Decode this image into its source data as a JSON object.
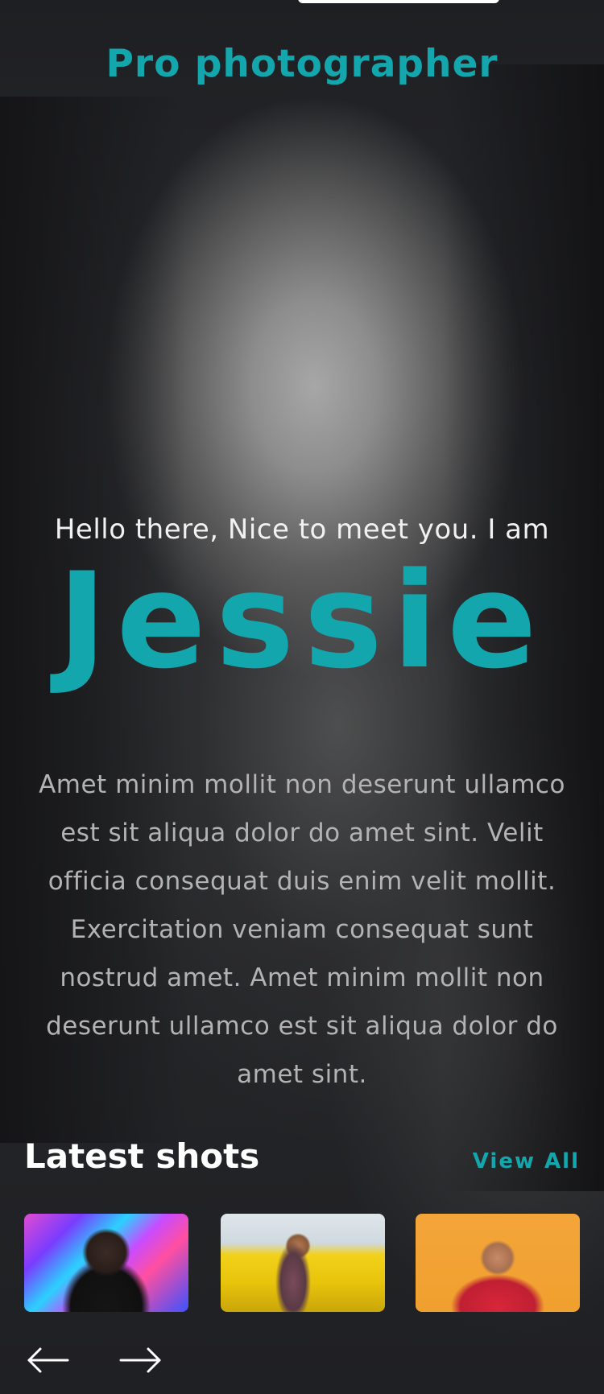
{
  "brand": {
    "title": "Pro photographer"
  },
  "hero": {
    "greeting": "Hello there, Nice to meet you. I am",
    "name": "Jessie",
    "bio": "Amet minim mollit non deserunt ullamco est sit aliqua dolor do amet sint. Velit officia consequat duis enim velit mollit. Exercitation veniam consequat sunt nostrud amet. Amet minim mollit non deserunt ullamco est sit aliqua dolor do amet sint."
  },
  "latest_shots": {
    "title": "Latest shots",
    "view_all_label": "View All",
    "thumbnails": [
      "portrait-neon",
      "portrait-field",
      "portrait-orange"
    ]
  },
  "carousel": {
    "prev_icon": "arrow-left-icon",
    "next_icon": "arrow-right-icon"
  },
  "colors": {
    "accent": "#13a6ad",
    "background": "#1f2023",
    "text": "#ffffff",
    "muted_text": "#b3b3b3"
  }
}
